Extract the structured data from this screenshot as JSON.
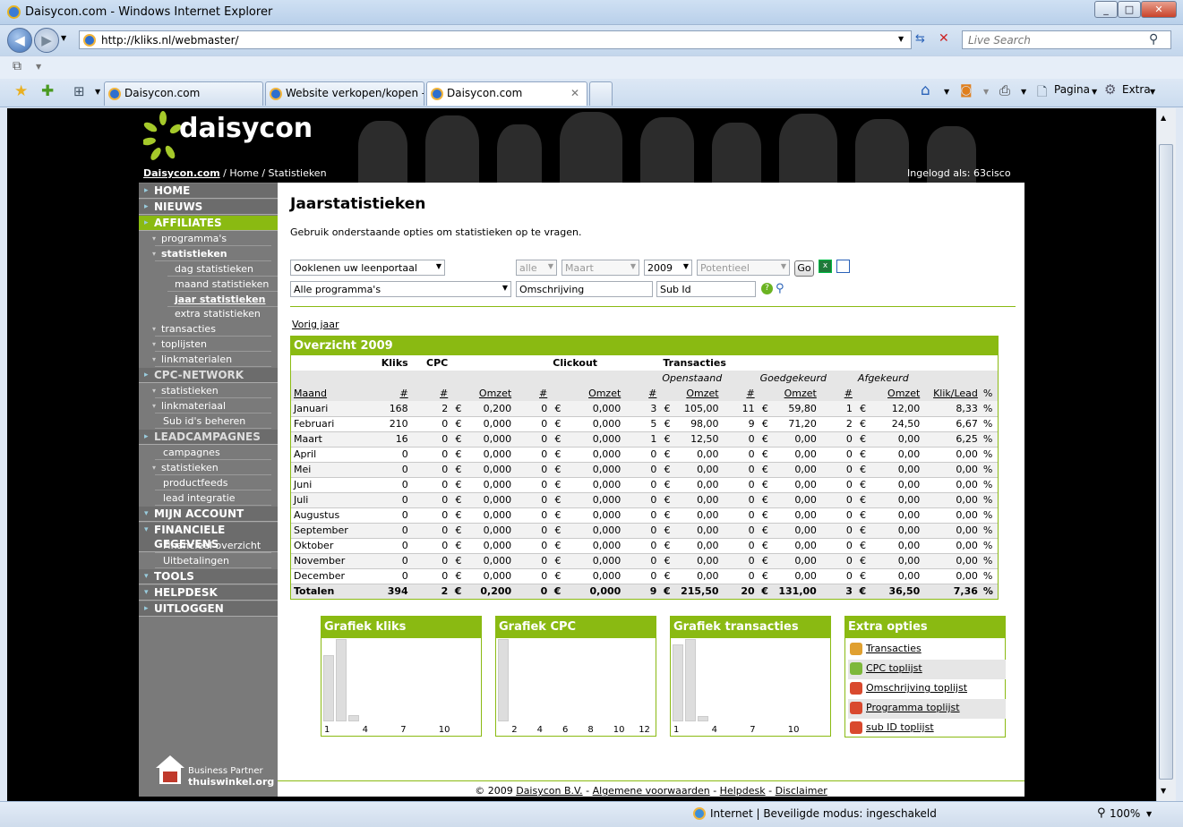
{
  "window": {
    "title": "Daisycon.com - Windows Internet Explorer",
    "url": "http://kliks.nl/webmaster/",
    "search_placeholder": "Live Search"
  },
  "tabs": [
    {
      "label": "Daisycon.com"
    },
    {
      "label": "Website verkopen/kopen -..."
    },
    {
      "label": "Daisycon.com"
    }
  ],
  "toolbar": {
    "page_label": "Pagina",
    "extra_label": "Extra"
  },
  "status": {
    "text": "Internet | Beveiligde modus: ingeschakeld",
    "zoom": "100%"
  },
  "site": {
    "logo": "daisycon",
    "breadcrumb": {
      "link": "Daisycon.com",
      "rest": "/  Home / Statistieken"
    },
    "logged_in": "Ingelogd als: 63cisco"
  },
  "menu": {
    "home": "HOME",
    "nieuws": "NIEUWS",
    "affiliates": "AFFILIATES",
    "programmas": "programma's",
    "statistieken": "statistieken",
    "dag": "dag statistieken",
    "maand": "maand statistieken",
    "jaar": "jaar statistieken",
    "extra": "extra statistieken",
    "transacties": "transacties",
    "toplijsten": "toplijsten",
    "linkmaterialen": "linkmaterialen",
    "cpc": "CPC-NETWORK",
    "cpc_stat": "statistieken",
    "cpc_link": "linkmateriaal",
    "subids": "Sub id's beheren",
    "lead": "LEADCAMPAGNES",
    "campagnes": "campagnes",
    "lead_stat": "statistieken",
    "productfeeds": "productfeeds",
    "leadint": "lead integratie",
    "account": "MIJN ACCOUNT",
    "fin": "FINANCIELE GEGEVENS",
    "finov": "Financieel overzicht",
    "uitbet": "Uitbetalingen",
    "tools": "TOOLS",
    "helpdesk": "HELPDESK",
    "uitloggen": "UITLOGGEN"
  },
  "partner": {
    "line1": "Business Partner",
    "line2": "thuiswinkel.org"
  },
  "page": {
    "title": "Jaarstatistieken",
    "intro": "Gebruik onderstaande opties om statistieken op te vragen.",
    "filters": {
      "program": "Ooklenen uw leenportaal",
      "all": "alle",
      "month": "Maart",
      "year": "2009",
      "potential": "Potentieel",
      "go": "Go",
      "programs": "Alle programma's",
      "description": "Omschrijving",
      "subid": "Sub Id"
    },
    "prev_year": "Vorig jaar"
  },
  "table": {
    "title": "Overzicht 2009",
    "groups": {
      "kliks": "Kliks",
      "cpc": "CPC",
      "clickout": "Clickout",
      "transacties": "Transacties"
    },
    "sub": {
      "open": "Openstaand",
      "good": "Goedgekeurd",
      "bad": "Afgekeurd"
    },
    "cols": {
      "maand": "Maand",
      "n": "#",
      "omzet": "Omzet",
      "kliklead": "Klik/Lead",
      "pct": "%",
      "eur": "€"
    },
    "rows": [
      [
        "Januari",
        "168",
        "2",
        "0,200",
        "0",
        "0,000",
        "3",
        "105,00",
        "11",
        "59,80",
        "1",
        "12,00",
        "8,33"
      ],
      [
        "Februari",
        "210",
        "0",
        "0,000",
        "0",
        "0,000",
        "5",
        "98,00",
        "9",
        "71,20",
        "2",
        "24,50",
        "6,67"
      ],
      [
        "Maart",
        "16",
        "0",
        "0,000",
        "0",
        "0,000",
        "1",
        "12,50",
        "0",
        "0,00",
        "0",
        "0,00",
        "6,25"
      ],
      [
        "April",
        "0",
        "0",
        "0,000",
        "0",
        "0,000",
        "0",
        "0,00",
        "0",
        "0,00",
        "0",
        "0,00",
        "0,00"
      ],
      [
        "Mei",
        "0",
        "0",
        "0,000",
        "0",
        "0,000",
        "0",
        "0,00",
        "0",
        "0,00",
        "0",
        "0,00",
        "0,00"
      ],
      [
        "Juni",
        "0",
        "0",
        "0,000",
        "0",
        "0,000",
        "0",
        "0,00",
        "0",
        "0,00",
        "0",
        "0,00",
        "0,00"
      ],
      [
        "Juli",
        "0",
        "0",
        "0,000",
        "0",
        "0,000",
        "0",
        "0,00",
        "0",
        "0,00",
        "0",
        "0,00",
        "0,00"
      ],
      [
        "Augustus",
        "0",
        "0",
        "0,000",
        "0",
        "0,000",
        "0",
        "0,00",
        "0",
        "0,00",
        "0",
        "0,00",
        "0,00"
      ],
      [
        "September",
        "0",
        "0",
        "0,000",
        "0",
        "0,000",
        "0",
        "0,00",
        "0",
        "0,00",
        "0",
        "0,00",
        "0,00"
      ],
      [
        "Oktober",
        "0",
        "0",
        "0,000",
        "0",
        "0,000",
        "0",
        "0,00",
        "0",
        "0,00",
        "0",
        "0,00",
        "0,00"
      ],
      [
        "November",
        "0",
        "0",
        "0,000",
        "0",
        "0,000",
        "0",
        "0,00",
        "0",
        "0,00",
        "0",
        "0,00",
        "0,00"
      ],
      [
        "December",
        "0",
        "0",
        "0,000",
        "0",
        "0,000",
        "0",
        "0,00",
        "0",
        "0,00",
        "0",
        "0,00",
        "0,00"
      ]
    ],
    "totals": [
      "Totalen",
      "394",
      "2",
      "0,200",
      "0",
      "0,000",
      "9",
      "215,50",
      "20",
      "131,00",
      "3",
      "36,50",
      "7,36"
    ]
  },
  "charts": [
    {
      "title": "Grafiek kliks",
      "values": [
        168,
        210,
        16,
        0,
        0,
        0,
        0,
        0,
        0,
        0,
        0,
        0
      ],
      "max": 210,
      "ticks": [
        "1",
        "4",
        "7",
        "10"
      ],
      "tick_months": [
        1,
        4,
        7,
        10
      ]
    },
    {
      "title": "Grafiek CPC",
      "values": [
        2,
        0,
        0,
        0,
        0,
        0,
        0,
        0,
        0,
        0,
        0,
        0
      ],
      "max": 2,
      "ticks": [
        "2",
        "4",
        "6",
        "8",
        "10",
        "12"
      ],
      "tick_months": [
        2,
        4,
        6,
        8,
        10,
        12
      ]
    },
    {
      "title": "Grafiek transacties",
      "values": [
        15,
        16,
        1,
        0,
        0,
        0,
        0,
        0,
        0,
        0,
        0,
        0
      ],
      "max": 16,
      "ticks": [
        "1",
        "4",
        "7",
        "10"
      ],
      "tick_months": [
        1,
        4,
        7,
        10
      ]
    }
  ],
  "extra": {
    "title": "Extra opties",
    "items": [
      "Transacties",
      "CPC toplijst",
      "Omschrijving toplijst",
      "Programma toplijst",
      "sub ID toplijst"
    ]
  },
  "footer": {
    "copy": "© 2009",
    "company": "Daisycon B.V.",
    "terms": "Algemene voorwaarden",
    "helpdesk": "Helpdesk",
    "disclaimer": "Disclaimer",
    "sep": "-"
  }
}
